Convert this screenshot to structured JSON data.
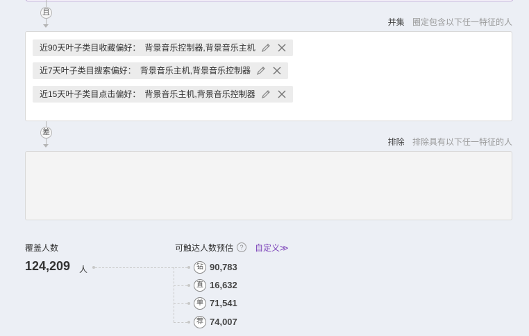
{
  "operators": {
    "intersect": "且",
    "difference": "差"
  },
  "union_section": {
    "name": "并集",
    "description": "圈定包含以下任一特征的人"
  },
  "union_tags": [
    {
      "key": "近90天叶子类目收藏偏好：",
      "value": "背景音乐控制器,背景音乐主机"
    },
    {
      "key": "近7天叶子类目搜索偏好：",
      "value": "背景音乐主机,背景音乐控制器"
    },
    {
      "key": "近15天叶子类目点击偏好：",
      "value": "背景音乐主机,背景音乐控制器"
    }
  ],
  "exclude_section": {
    "name": "排除",
    "description": "排除具有以下任一特征的人"
  },
  "coverage": {
    "label": "覆盖人数",
    "value": "124,209",
    "unit": "人"
  },
  "reach": {
    "label": "可触达人数预估",
    "help": "?",
    "custom_link": "自定义≫",
    "channels": [
      {
        "badge": "钻",
        "value": "90,783"
      },
      {
        "badge": "直",
        "value": "16,632"
      },
      {
        "badge": "单",
        "value": "71,541"
      },
      {
        "badge": "荐",
        "value": "74,007"
      }
    ]
  },
  "icons": {
    "edit": "pencil-icon",
    "remove": "close-icon"
  }
}
